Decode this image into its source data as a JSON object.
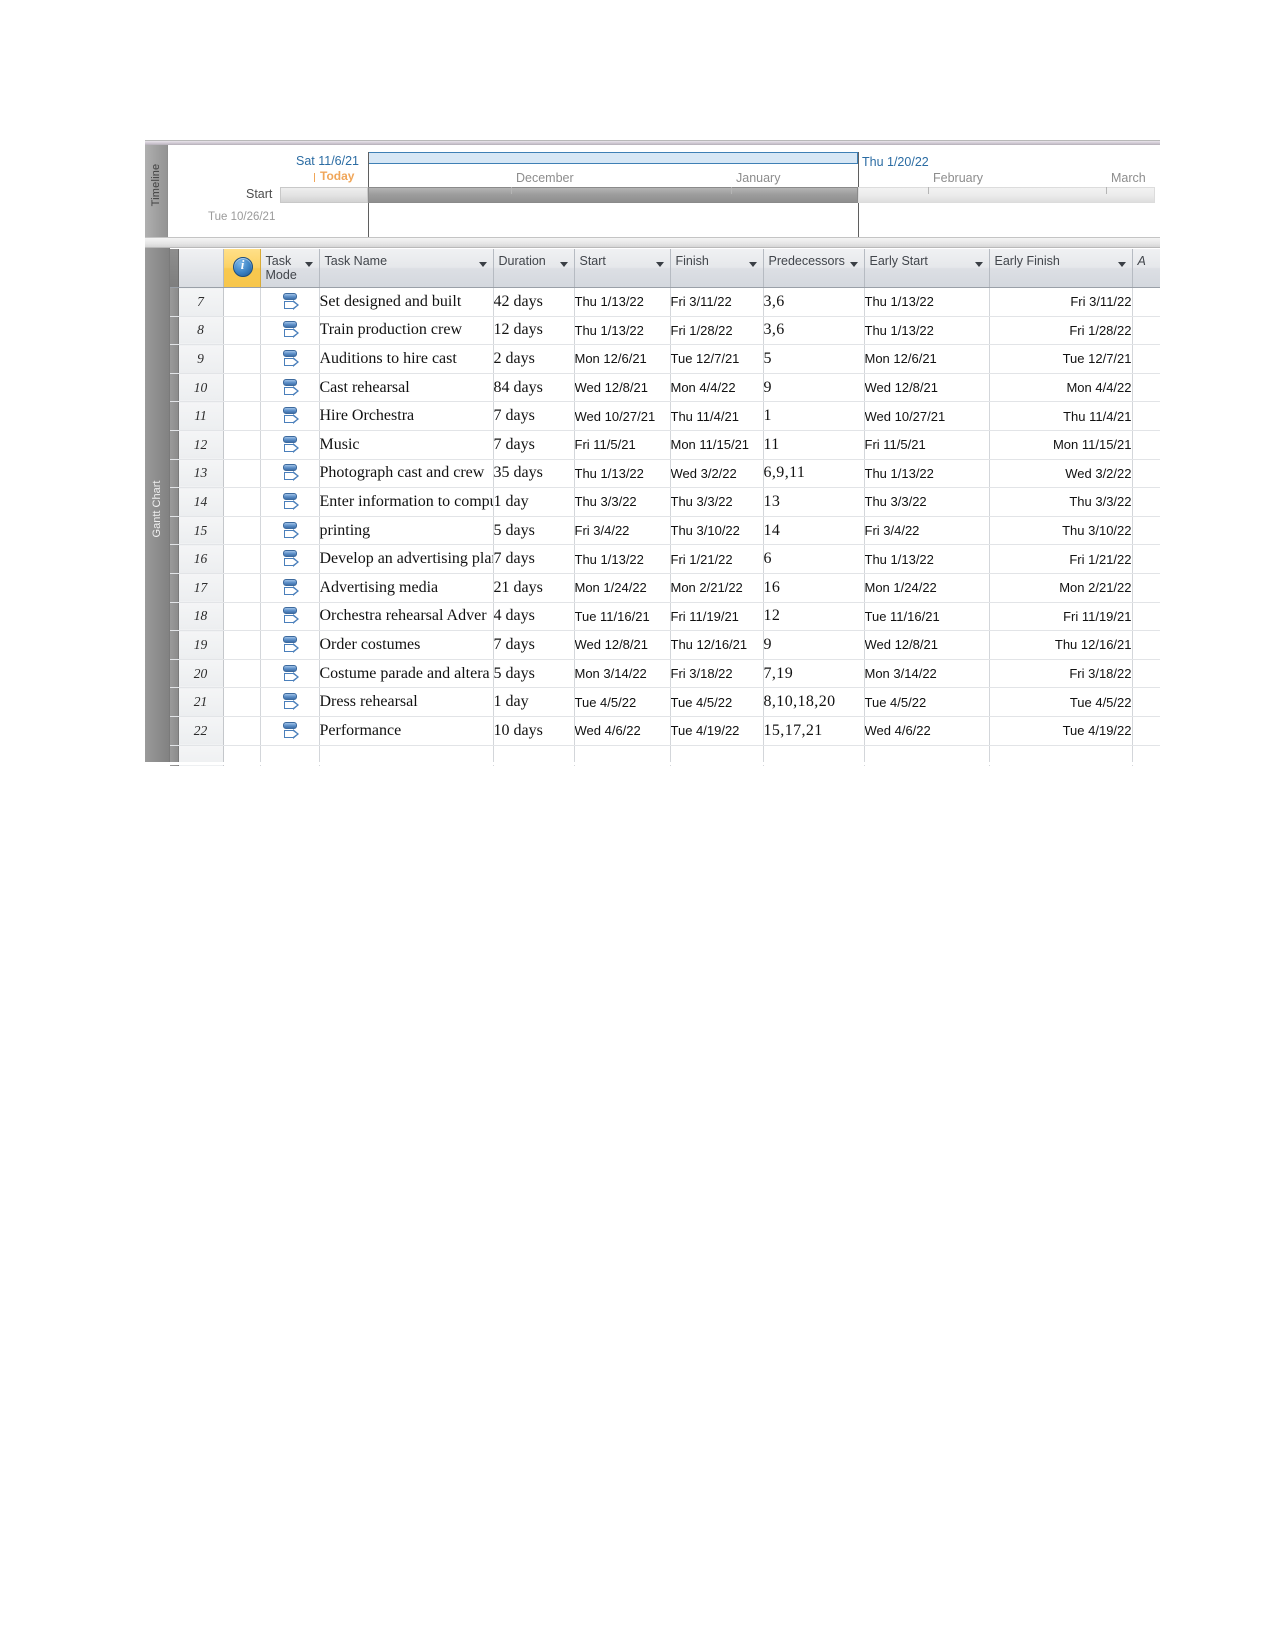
{
  "timeline": {
    "pane_label": "Timeline",
    "left_date": "Sat 11/6/21",
    "right_date": "Thu 1/20/22",
    "today_label": "Today",
    "start_label": "Start",
    "start_date": "Tue 10/26/21",
    "months": [
      "December",
      "January",
      "February",
      "March"
    ]
  },
  "gantt": {
    "pane_label": "Gantt Chart",
    "columns": [
      {
        "key": "info",
        "label": "",
        "icon": "info-icon"
      },
      {
        "key": "mode",
        "label": "Task Mode"
      },
      {
        "key": "name",
        "label": "Task Name"
      },
      {
        "key": "duration",
        "label": "Duration"
      },
      {
        "key": "start",
        "label": "Start"
      },
      {
        "key": "finish",
        "label": "Finish"
      },
      {
        "key": "predecessors",
        "label": "Predecessors"
      },
      {
        "key": "early_start",
        "label": "Early Start"
      },
      {
        "key": "early_finish",
        "label": "Early Finish"
      },
      {
        "key": "extra",
        "label": "A"
      }
    ],
    "rows": [
      {
        "id": "7",
        "mode": "auto-schedule-icon",
        "name": "Set designed and built",
        "duration": "42 days",
        "start": "Thu 1/13/22",
        "finish": "Fri 3/11/22",
        "predecessors": "3,6",
        "early_start": "Thu 1/13/22",
        "early_finish": "Fri 3/11/22"
      },
      {
        "id": "8",
        "mode": "auto-schedule-icon",
        "name": "Train production crew",
        "duration": "12 days",
        "start": "Thu 1/13/22",
        "finish": "Fri 1/28/22",
        "predecessors": "3,6",
        "early_start": "Thu 1/13/22",
        "early_finish": "Fri 1/28/22"
      },
      {
        "id": "9",
        "mode": "auto-schedule-icon",
        "name": "Auditions to hire cast",
        "duration": "2 days",
        "start": "Mon 12/6/21",
        "finish": "Tue 12/7/21",
        "predecessors": "5",
        "early_start": "Mon 12/6/21",
        "early_finish": "Tue 12/7/21"
      },
      {
        "id": "10",
        "mode": "auto-schedule-icon",
        "name": "Cast rehearsal",
        "duration": "84 days",
        "start": "Wed 12/8/21",
        "finish": "Mon 4/4/22",
        "predecessors": "9",
        "early_start": "Wed 12/8/21",
        "early_finish": "Mon 4/4/22"
      },
      {
        "id": "11",
        "mode": "auto-schedule-icon",
        "name": "Hire Orchestra",
        "duration": "7 days",
        "start": "Wed 10/27/21",
        "finish": "Thu 11/4/21",
        "predecessors": "1",
        "early_start": "Wed 10/27/21",
        "early_finish": "Thu 11/4/21"
      },
      {
        "id": "12",
        "mode": "auto-schedule-icon",
        "name": "Music",
        "duration": "7 days",
        "start": "Fri 11/5/21",
        "finish": "Mon 11/15/21",
        "predecessors": "11",
        "early_start": "Fri 11/5/21",
        "early_finish": "Mon 11/15/21"
      },
      {
        "id": "13",
        "mode": "auto-schedule-icon",
        "name": "Photograph cast and crew",
        "duration": "35 days",
        "start": "Thu 1/13/22",
        "finish": "Wed 3/2/22",
        "predecessors": "6,9,11",
        "early_start": "Thu 1/13/22",
        "early_finish": "Wed 3/2/22"
      },
      {
        "id": "14",
        "mode": "auto-schedule-icon",
        "name": "Enter information to compu",
        "duration": "1 day",
        "start": "Thu 3/3/22",
        "finish": "Thu 3/3/22",
        "predecessors": "13",
        "early_start": "Thu 3/3/22",
        "early_finish": "Thu 3/3/22"
      },
      {
        "id": "15",
        "mode": "auto-schedule-icon",
        "name": "printing",
        "duration": "5 days",
        "start": "Fri 3/4/22",
        "finish": "Thu 3/10/22",
        "predecessors": "14",
        "early_start": "Fri 3/4/22",
        "early_finish": "Thu 3/10/22"
      },
      {
        "id": "16",
        "mode": "auto-schedule-icon",
        "name": "Develop an advertising plan",
        "duration": "7 days",
        "start": "Thu 1/13/22",
        "finish": "Fri 1/21/22",
        "predecessors": "6",
        "early_start": "Thu 1/13/22",
        "early_finish": "Fri 1/21/22"
      },
      {
        "id": "17",
        "mode": "auto-schedule-icon",
        "name": "Advertising media",
        "duration": "21 days",
        "start": "Mon 1/24/22",
        "finish": "Mon 2/21/22",
        "predecessors": "16",
        "early_start": "Mon 1/24/22",
        "early_finish": "Mon 2/21/22"
      },
      {
        "id": "18",
        "mode": "auto-schedule-icon",
        "name": "Orchestra rehearsal Adver",
        "duration": "4 days",
        "start": "Tue 11/16/21",
        "finish": "Fri 11/19/21",
        "predecessors": "12",
        "early_start": "Tue 11/16/21",
        "early_finish": "Fri 11/19/21"
      },
      {
        "id": "19",
        "mode": "auto-schedule-icon",
        "name": "Order costumes",
        "duration": "7 days",
        "start": "Wed 12/8/21",
        "finish": "Thu 12/16/21",
        "predecessors": "9",
        "early_start": "Wed 12/8/21",
        "early_finish": "Thu 12/16/21"
      },
      {
        "id": "20",
        "mode": "auto-schedule-icon",
        "name": "Costume parade and altera",
        "duration": "5 days",
        "start": "Mon 3/14/22",
        "finish": "Fri 3/18/22",
        "predecessors": "7,19",
        "early_start": "Mon 3/14/22",
        "early_finish": "Fri 3/18/22"
      },
      {
        "id": "21",
        "mode": "auto-schedule-icon",
        "name": "Dress rehearsal",
        "duration": "1 day",
        "start": "Tue 4/5/22",
        "finish": "Tue 4/5/22",
        "predecessors": "8,10,18,20",
        "early_start": "Tue 4/5/22",
        "early_finish": "Tue 4/5/22"
      },
      {
        "id": "22",
        "mode": "auto-schedule-icon",
        "name": "Performance",
        "duration": "10 days",
        "start": "Wed 4/6/22",
        "finish": "Tue 4/19/22",
        "predecessors": "15,17,21",
        "early_start": "Wed 4/6/22",
        "early_finish": "Tue 4/19/22"
      }
    ]
  },
  "colors": {
    "accent_blue": "#2b6ca3",
    "today_orange": "#f0a659",
    "info_yellow": "#f8c84f",
    "band_blue": "#d7e7f5"
  }
}
